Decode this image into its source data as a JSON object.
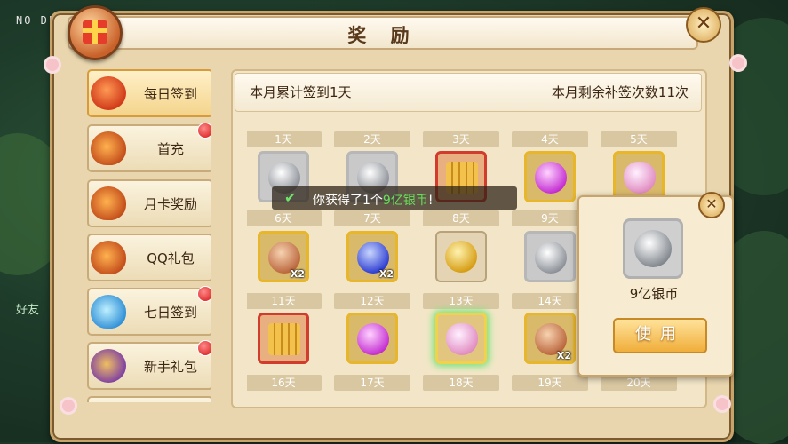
{
  "debug_label": "NO DE",
  "side_hint_1": "好友",
  "title": "奖 励",
  "close_glyph": "✕",
  "sidebar": {
    "items": [
      {
        "label": "每日签到",
        "icon": "coin-pouch-icon",
        "active": true,
        "red_dot": false
      },
      {
        "label": "首充",
        "icon": "money-bag-icon",
        "active": false,
        "red_dot": true
      },
      {
        "label": "月卡奖励",
        "icon": "money-bag-icon",
        "active": false,
        "red_dot": false
      },
      {
        "label": "QQ礼包",
        "icon": "money-bag-icon",
        "active": false,
        "red_dot": false
      },
      {
        "label": "七日签到",
        "icon": "blue-bag-icon",
        "active": false,
        "red_dot": true
      },
      {
        "label": "新手礼包",
        "icon": "purple-egg-icon",
        "active": false,
        "red_dot": true
      }
    ]
  },
  "summary": {
    "left": "本月累计签到1天",
    "right": "本月剩余补签次数11次"
  },
  "grid": {
    "days": [
      {
        "label": "1天",
        "item": "silver-coin-icon",
        "frame": "silver",
        "qty": ""
      },
      {
        "label": "2天",
        "item": "silver-coin-icon",
        "frame": "silver",
        "qty": ""
      },
      {
        "label": "3天",
        "item": "golden-scroll-icon",
        "frame": "red",
        "qty": ""
      },
      {
        "label": "4天",
        "item": "pink-orb-icon",
        "frame": "gold",
        "qty": ""
      },
      {
        "label": "5天",
        "item": "pink-egg-icon",
        "frame": "gold",
        "qty": ""
      },
      {
        "label": "6天",
        "item": "pet-bag-icon",
        "frame": "gold",
        "qty": "X2"
      },
      {
        "label": "7天",
        "item": "blue-orb-icon",
        "frame": "gold",
        "qty": "X2"
      },
      {
        "label": "8天",
        "item": "gold-coin-icon",
        "frame": "plain",
        "qty": ""
      },
      {
        "label": "9天",
        "item": "silver-coin-icon",
        "frame": "silver",
        "qty": ""
      },
      {
        "label": "11天",
        "item": "golden-scroll-icon",
        "frame": "red",
        "qty": ""
      },
      {
        "label": "12天",
        "item": "pink-orb-icon",
        "frame": "gold",
        "qty": ""
      },
      {
        "label": "13天",
        "item": "pink-egg-icon",
        "frame": "greenglow",
        "qty": ""
      },
      {
        "label": "14天",
        "item": "pet-bag-icon",
        "frame": "gold",
        "qty": "X2"
      },
      {
        "label": "16天",
        "item": "",
        "frame": "none",
        "qty": ""
      },
      {
        "label": "17天",
        "item": "",
        "frame": "none",
        "qty": ""
      },
      {
        "label": "18天",
        "item": "",
        "frame": "none",
        "qty": ""
      },
      {
        "label": "19天",
        "item": "",
        "frame": "none",
        "qty": ""
      },
      {
        "label": "20天",
        "item": "",
        "frame": "none",
        "qty": ""
      }
    ]
  },
  "toast": {
    "prefix": "你获得了1个",
    "item": "9亿银币",
    "suffix": "!"
  },
  "popup": {
    "item_name": "9亿银币",
    "use_label": "使用"
  }
}
